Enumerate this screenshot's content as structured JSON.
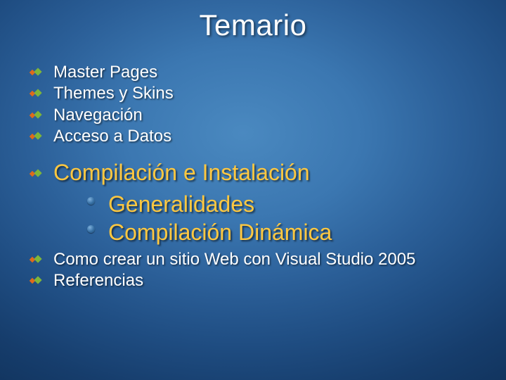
{
  "title": "Temario",
  "items": [
    {
      "label": "Master Pages"
    },
    {
      "label": "Themes y Skins"
    },
    {
      "label": "Navegación"
    },
    {
      "label": "Acceso a Datos"
    }
  ],
  "section": {
    "label": "Compilación e Instalación",
    "subitems": [
      {
        "label": "Generalidades"
      },
      {
        "label": "Compilación Dinámica"
      }
    ]
  },
  "items_after": [
    {
      "label": "Como crear un sitio Web con Visual Studio 2005"
    },
    {
      "label": "Referencias"
    }
  ]
}
